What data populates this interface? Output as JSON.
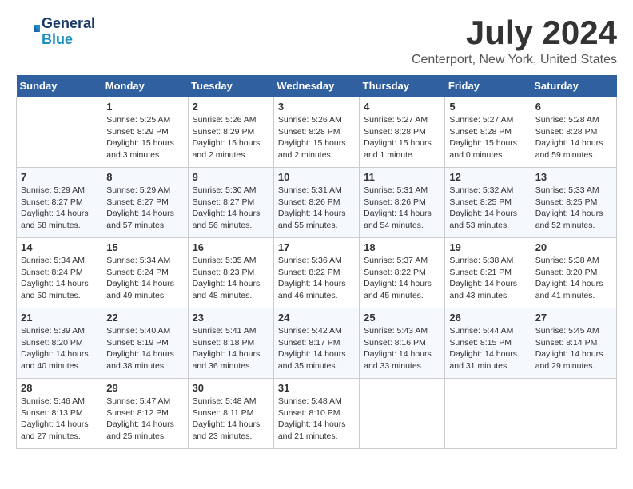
{
  "header": {
    "logo_line1": "General",
    "logo_line2": "Blue",
    "month": "July 2024",
    "location": "Centerport, New York, United States"
  },
  "weekdays": [
    "Sunday",
    "Monday",
    "Tuesday",
    "Wednesday",
    "Thursday",
    "Friday",
    "Saturday"
  ],
  "weeks": [
    [
      {
        "day": "",
        "empty": true
      },
      {
        "day": "1",
        "sunrise": "5:25 AM",
        "sunset": "8:29 PM",
        "daylight": "15 hours and 3 minutes."
      },
      {
        "day": "2",
        "sunrise": "5:26 AM",
        "sunset": "8:29 PM",
        "daylight": "15 hours and 2 minutes."
      },
      {
        "day": "3",
        "sunrise": "5:26 AM",
        "sunset": "8:28 PM",
        "daylight": "15 hours and 2 minutes."
      },
      {
        "day": "4",
        "sunrise": "5:27 AM",
        "sunset": "8:28 PM",
        "daylight": "15 hours and 1 minute."
      },
      {
        "day": "5",
        "sunrise": "5:27 AM",
        "sunset": "8:28 PM",
        "daylight": "15 hours and 0 minutes."
      },
      {
        "day": "6",
        "sunrise": "5:28 AM",
        "sunset": "8:28 PM",
        "daylight": "14 hours and 59 minutes."
      }
    ],
    [
      {
        "day": "7",
        "sunrise": "5:29 AM",
        "sunset": "8:27 PM",
        "daylight": "14 hours and 58 minutes."
      },
      {
        "day": "8",
        "sunrise": "5:29 AM",
        "sunset": "8:27 PM",
        "daylight": "14 hours and 57 minutes."
      },
      {
        "day": "9",
        "sunrise": "5:30 AM",
        "sunset": "8:27 PM",
        "daylight": "14 hours and 56 minutes."
      },
      {
        "day": "10",
        "sunrise": "5:31 AM",
        "sunset": "8:26 PM",
        "daylight": "14 hours and 55 minutes."
      },
      {
        "day": "11",
        "sunrise": "5:31 AM",
        "sunset": "8:26 PM",
        "daylight": "14 hours and 54 minutes."
      },
      {
        "day": "12",
        "sunrise": "5:32 AM",
        "sunset": "8:25 PM",
        "daylight": "14 hours and 53 minutes."
      },
      {
        "day": "13",
        "sunrise": "5:33 AM",
        "sunset": "8:25 PM",
        "daylight": "14 hours and 52 minutes."
      }
    ],
    [
      {
        "day": "14",
        "sunrise": "5:34 AM",
        "sunset": "8:24 PM",
        "daylight": "14 hours and 50 minutes."
      },
      {
        "day": "15",
        "sunrise": "5:34 AM",
        "sunset": "8:24 PM",
        "daylight": "14 hours and 49 minutes."
      },
      {
        "day": "16",
        "sunrise": "5:35 AM",
        "sunset": "8:23 PM",
        "daylight": "14 hours and 48 minutes."
      },
      {
        "day": "17",
        "sunrise": "5:36 AM",
        "sunset": "8:22 PM",
        "daylight": "14 hours and 46 minutes."
      },
      {
        "day": "18",
        "sunrise": "5:37 AM",
        "sunset": "8:22 PM",
        "daylight": "14 hours and 45 minutes."
      },
      {
        "day": "19",
        "sunrise": "5:38 AM",
        "sunset": "8:21 PM",
        "daylight": "14 hours and 43 minutes."
      },
      {
        "day": "20",
        "sunrise": "5:38 AM",
        "sunset": "8:20 PM",
        "daylight": "14 hours and 41 minutes."
      }
    ],
    [
      {
        "day": "21",
        "sunrise": "5:39 AM",
        "sunset": "8:20 PM",
        "daylight": "14 hours and 40 minutes."
      },
      {
        "day": "22",
        "sunrise": "5:40 AM",
        "sunset": "8:19 PM",
        "daylight": "14 hours and 38 minutes."
      },
      {
        "day": "23",
        "sunrise": "5:41 AM",
        "sunset": "8:18 PM",
        "daylight": "14 hours and 36 minutes."
      },
      {
        "day": "24",
        "sunrise": "5:42 AM",
        "sunset": "8:17 PM",
        "daylight": "14 hours and 35 minutes."
      },
      {
        "day": "25",
        "sunrise": "5:43 AM",
        "sunset": "8:16 PM",
        "daylight": "14 hours and 33 minutes."
      },
      {
        "day": "26",
        "sunrise": "5:44 AM",
        "sunset": "8:15 PM",
        "daylight": "14 hours and 31 minutes."
      },
      {
        "day": "27",
        "sunrise": "5:45 AM",
        "sunset": "8:14 PM",
        "daylight": "14 hours and 29 minutes."
      }
    ],
    [
      {
        "day": "28",
        "sunrise": "5:46 AM",
        "sunset": "8:13 PM",
        "daylight": "14 hours and 27 minutes."
      },
      {
        "day": "29",
        "sunrise": "5:47 AM",
        "sunset": "8:12 PM",
        "daylight": "14 hours and 25 minutes."
      },
      {
        "day": "30",
        "sunrise": "5:48 AM",
        "sunset": "8:11 PM",
        "daylight": "14 hours and 23 minutes."
      },
      {
        "day": "31",
        "sunrise": "5:48 AM",
        "sunset": "8:10 PM",
        "daylight": "14 hours and 21 minutes."
      },
      {
        "day": "",
        "empty": true
      },
      {
        "day": "",
        "empty": true
      },
      {
        "day": "",
        "empty": true
      }
    ]
  ],
  "labels": {
    "sunrise_prefix": "Sunrise: ",
    "sunset_prefix": "Sunset: ",
    "daylight_prefix": "Daylight: "
  }
}
